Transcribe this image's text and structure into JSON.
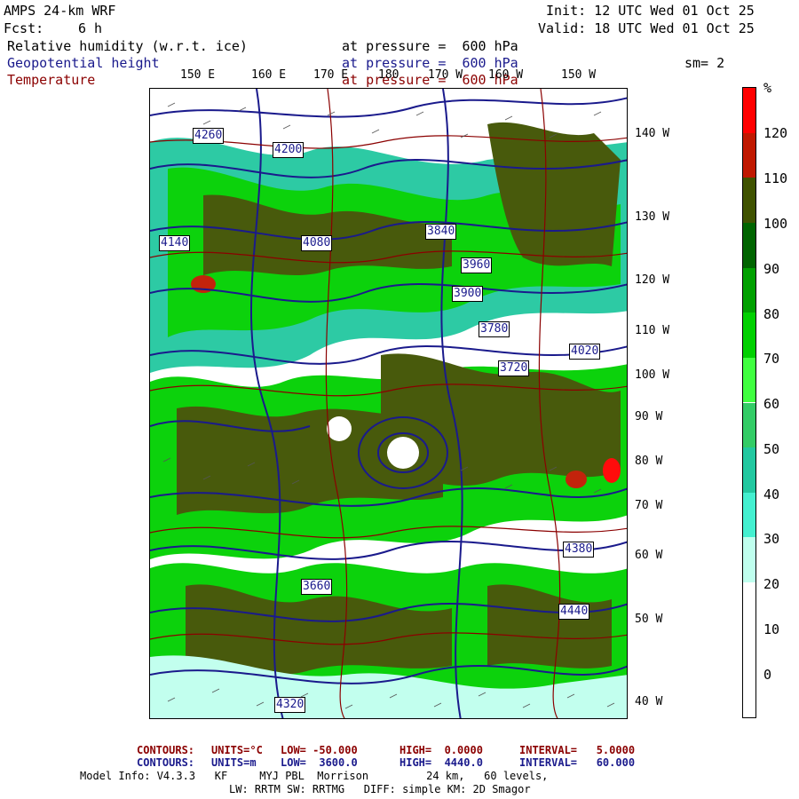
{
  "header": {
    "model": "AMPS 24-km WRF",
    "fcst_label": "Fcst:",
    "fcst_value": "6 h",
    "init": "Init: 12 UTC Wed 01 Oct 25",
    "valid": "Valid: 18 UTC Wed 01 Oct 25"
  },
  "fields": [
    {
      "name": "Relative humidity (w.r.t. ice)",
      "level": "at pressure =  600 hPa",
      "color": "#000000"
    },
    {
      "name": "Geopotential height",
      "level": "at pressure =  600 hPa",
      "color": "#1a1a8c"
    },
    {
      "name": "Temperature",
      "level": "at pressure =  600 hPa",
      "color": "#8b0000"
    }
  ],
  "smoothing": "sm= 2",
  "lon_labels": [
    "150 E",
    "160 E",
    "170 E",
    "180",
    "170 W",
    "160 W",
    "150 W"
  ],
  "lat_labels": [
    "140 W",
    "130 W",
    "120 W",
    "110 W",
    "100 W",
    "90 W",
    "80 W",
    "70 W",
    "60 W",
    "50 W",
    "40 W"
  ],
  "height_labels": [
    "4260",
    "4200",
    "4080",
    "4140",
    "4020",
    "3960",
    "3900",
    "3840",
    "3780",
    "3720",
    "3660",
    "4320",
    "4380",
    "4440"
  ],
  "colorbar": {
    "unit": "%",
    "levels": [
      "120",
      "110",
      "100",
      "90",
      "80",
      "70",
      "60",
      "50",
      "40",
      "30",
      "20",
      "10",
      "0"
    ],
    "colors": [
      "#ff0000",
      "#c01800",
      "#3f5200",
      "#006400",
      "#00a000",
      "#00d000",
      "#40ff40",
      "#33cc66",
      "#22c8a0",
      "#44f0d0",
      "#bfffee"
    ]
  },
  "footer": {
    "temp_line": {
      "label": "CONTOURS:",
      "units": "UNITS=°C",
      "low": "LOW= -50.000",
      "high": "HIGH=  0.0000",
      "interval": "INTERVAL=   5.0000"
    },
    "height_line": {
      "label": "CONTOURS:",
      "units": "UNITS=m",
      "low": "LOW=  3600.0",
      "high": "HIGH=  4440.0",
      "interval": "INTERVAL=   60.000"
    },
    "model_info": "Model Info: V4.3.3   KF     MYJ PBL  Morrison         24 km,   60 levels,",
    "physics": "LW: RRTM SW: RRTMG   DIFF: simple KM: 2D Smagor"
  }
}
